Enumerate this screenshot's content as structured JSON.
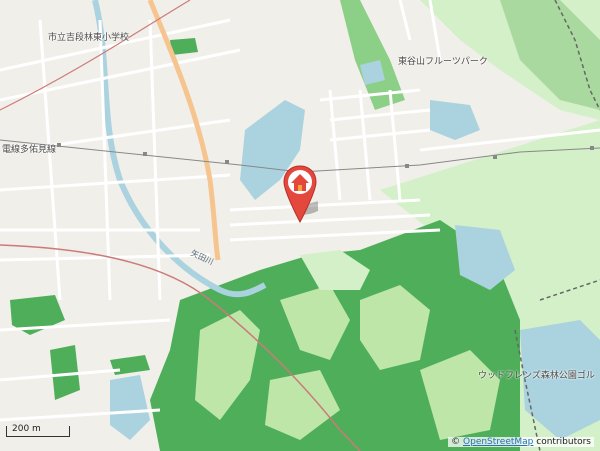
{
  "map": {
    "labels": {
      "school": "市立吉段林東小学校",
      "fruit_park": "東谷山フルーツパーク",
      "powerline": "電線多佑見線",
      "forest_park": "ウッドフレンズ森林公園ゴル",
      "river": "矢田川"
    },
    "scale": {
      "label": "200 m"
    },
    "attribution": {
      "prefix": "© ",
      "link": "OpenStreetMap",
      "suffix": " contributors"
    },
    "marker": {
      "icon": "home-marker-icon",
      "color": "#e4483c"
    },
    "colors": {
      "land": "#f1efea",
      "forest": "#4fae5a",
      "golf": "#bde6a8",
      "park": "#d3f0c8",
      "water": "#aad3df",
      "road": "#ffffff",
      "major_road": "#f6c48e",
      "rail": "#666666"
    }
  }
}
